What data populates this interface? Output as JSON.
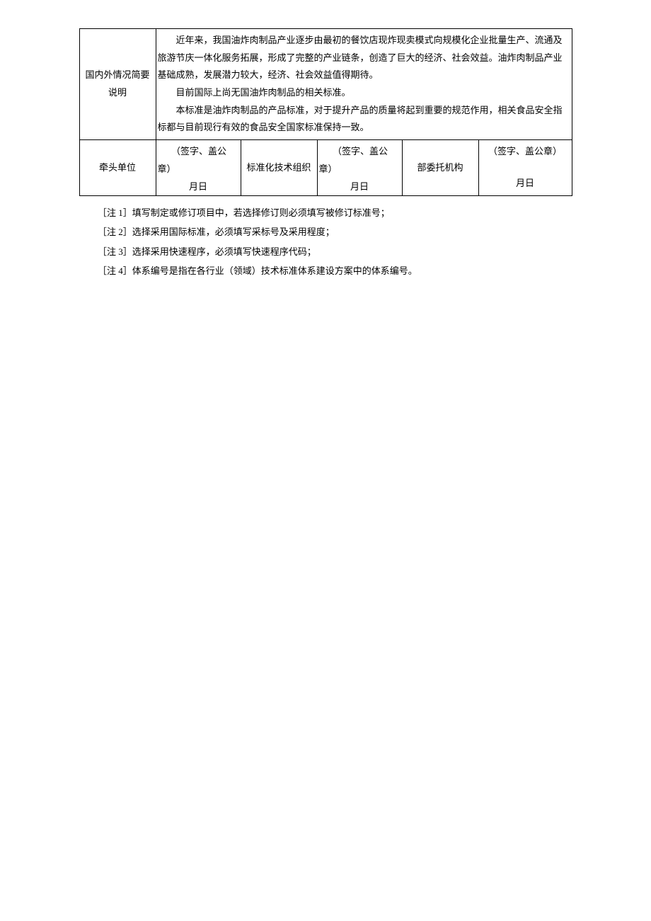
{
  "table": {
    "row1": {
      "label": "国内外情况简要说明",
      "paragraph1": "近年来，我国油炸肉制品产业逐步由最初的餐饮店现炸现卖模式向规模化企业批量生产、流通及旅游节庆一体化服务拓展，形成了完整的产业链条，创造了巨大的经济、社会效益。油炸肉制品产业基础成熟，发展潜力较大，经济、社会效益值得期待。",
      "paragraph2": "目前国际上尚无国油炸肉制品的相关标准。",
      "paragraph3": "本标准是油炸肉制品的产品标准，对于提升产品的质量将起到重要的规范作用，相关食品安全指标都与目前现行有效的食品安全国家标准保持一致。"
    },
    "row2": {
      "col1_label": "牵头单位",
      "col2_sig": "（签字、盖公章）",
      "col2_date": "月日",
      "col3_label": "标准化技术组织",
      "col4_sig": "（签字、盖公章）",
      "col4_date": "月日",
      "col5_label": "部委托机构",
      "col6_sig": "（签字、盖公章）",
      "col6_date": "月日"
    }
  },
  "notes": {
    "n1": "［注 1］填写制定或修订项目中，若选择修订则必须填写被修订标准号；",
    "n2": "［注 2］选择采用国际标准，必须填写采标号及采用程度；",
    "n3": "［注 3］选择采用快速程序，必须填写快速程序代码；",
    "n4": "［注 4］体系编号是指在各行业（领域）技术标准体系建设方案中的体系编号。"
  }
}
